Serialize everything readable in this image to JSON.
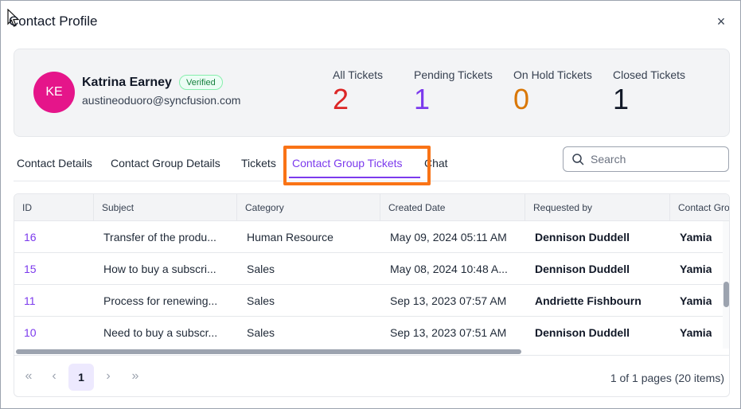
{
  "dialog": {
    "title": "Contact Profile",
    "close_glyph": "×"
  },
  "contact": {
    "initials": "KE",
    "name": "Katrina Earney",
    "badge": "Verified",
    "email": "austineoduoro@syncfusion.com",
    "avatar_color": "#e5158a"
  },
  "stats": [
    {
      "label": "All Tickets",
      "value": "2",
      "color": "#dc2626"
    },
    {
      "label": "Pending Tickets",
      "value": "1",
      "color": "#7c3aed"
    },
    {
      "label": "On Hold Tickets",
      "value": "0",
      "color": "#d97706"
    },
    {
      "label": "Closed Tickets",
      "value": "1",
      "color": "#111827"
    }
  ],
  "tabs": [
    {
      "label": "Contact Details"
    },
    {
      "label": "Contact Group Details"
    },
    {
      "label": "Tickets"
    },
    {
      "label": "Contact Group Tickets",
      "active": true
    },
    {
      "label": "Chat"
    }
  ],
  "search": {
    "placeholder": "Search",
    "value": ""
  },
  "table": {
    "columns": [
      "ID",
      "Subject",
      "Category",
      "Created Date",
      "Requested by",
      "Contact Gro"
    ],
    "rows": [
      {
        "id": "16",
        "subject": "Transfer of the produ...",
        "category": "Human Resource",
        "created": "May 09, 2024 05:11 AM",
        "requested_by": "Dennison Duddell",
        "group": "Yamia"
      },
      {
        "id": "15",
        "subject": "How to buy a subscri...",
        "category": "Sales",
        "created": "May 08, 2024 10:48 A...",
        "requested_by": "Dennison Duddell",
        "group": "Yamia"
      },
      {
        "id": "11",
        "subject": "Process for renewing...",
        "category": "Sales",
        "created": "Sep 13, 2023 07:57 AM",
        "requested_by": "Andriette Fishbourn",
        "group": "Yamia"
      },
      {
        "id": "10",
        "subject": "Need to buy a subscr...",
        "category": "Sales",
        "created": "Sep 13, 2023 07:51 AM",
        "requested_by": "Dennison Duddell",
        "group": "Yamia"
      }
    ]
  },
  "pager": {
    "first_glyph": "«",
    "prev_glyph": "‹",
    "current_page": "1",
    "next_glyph": "›",
    "last_glyph": "»",
    "info": "1 of 1 pages (20 items)"
  },
  "accent_color": "#7c3aed",
  "highlight_color": "#f97316"
}
